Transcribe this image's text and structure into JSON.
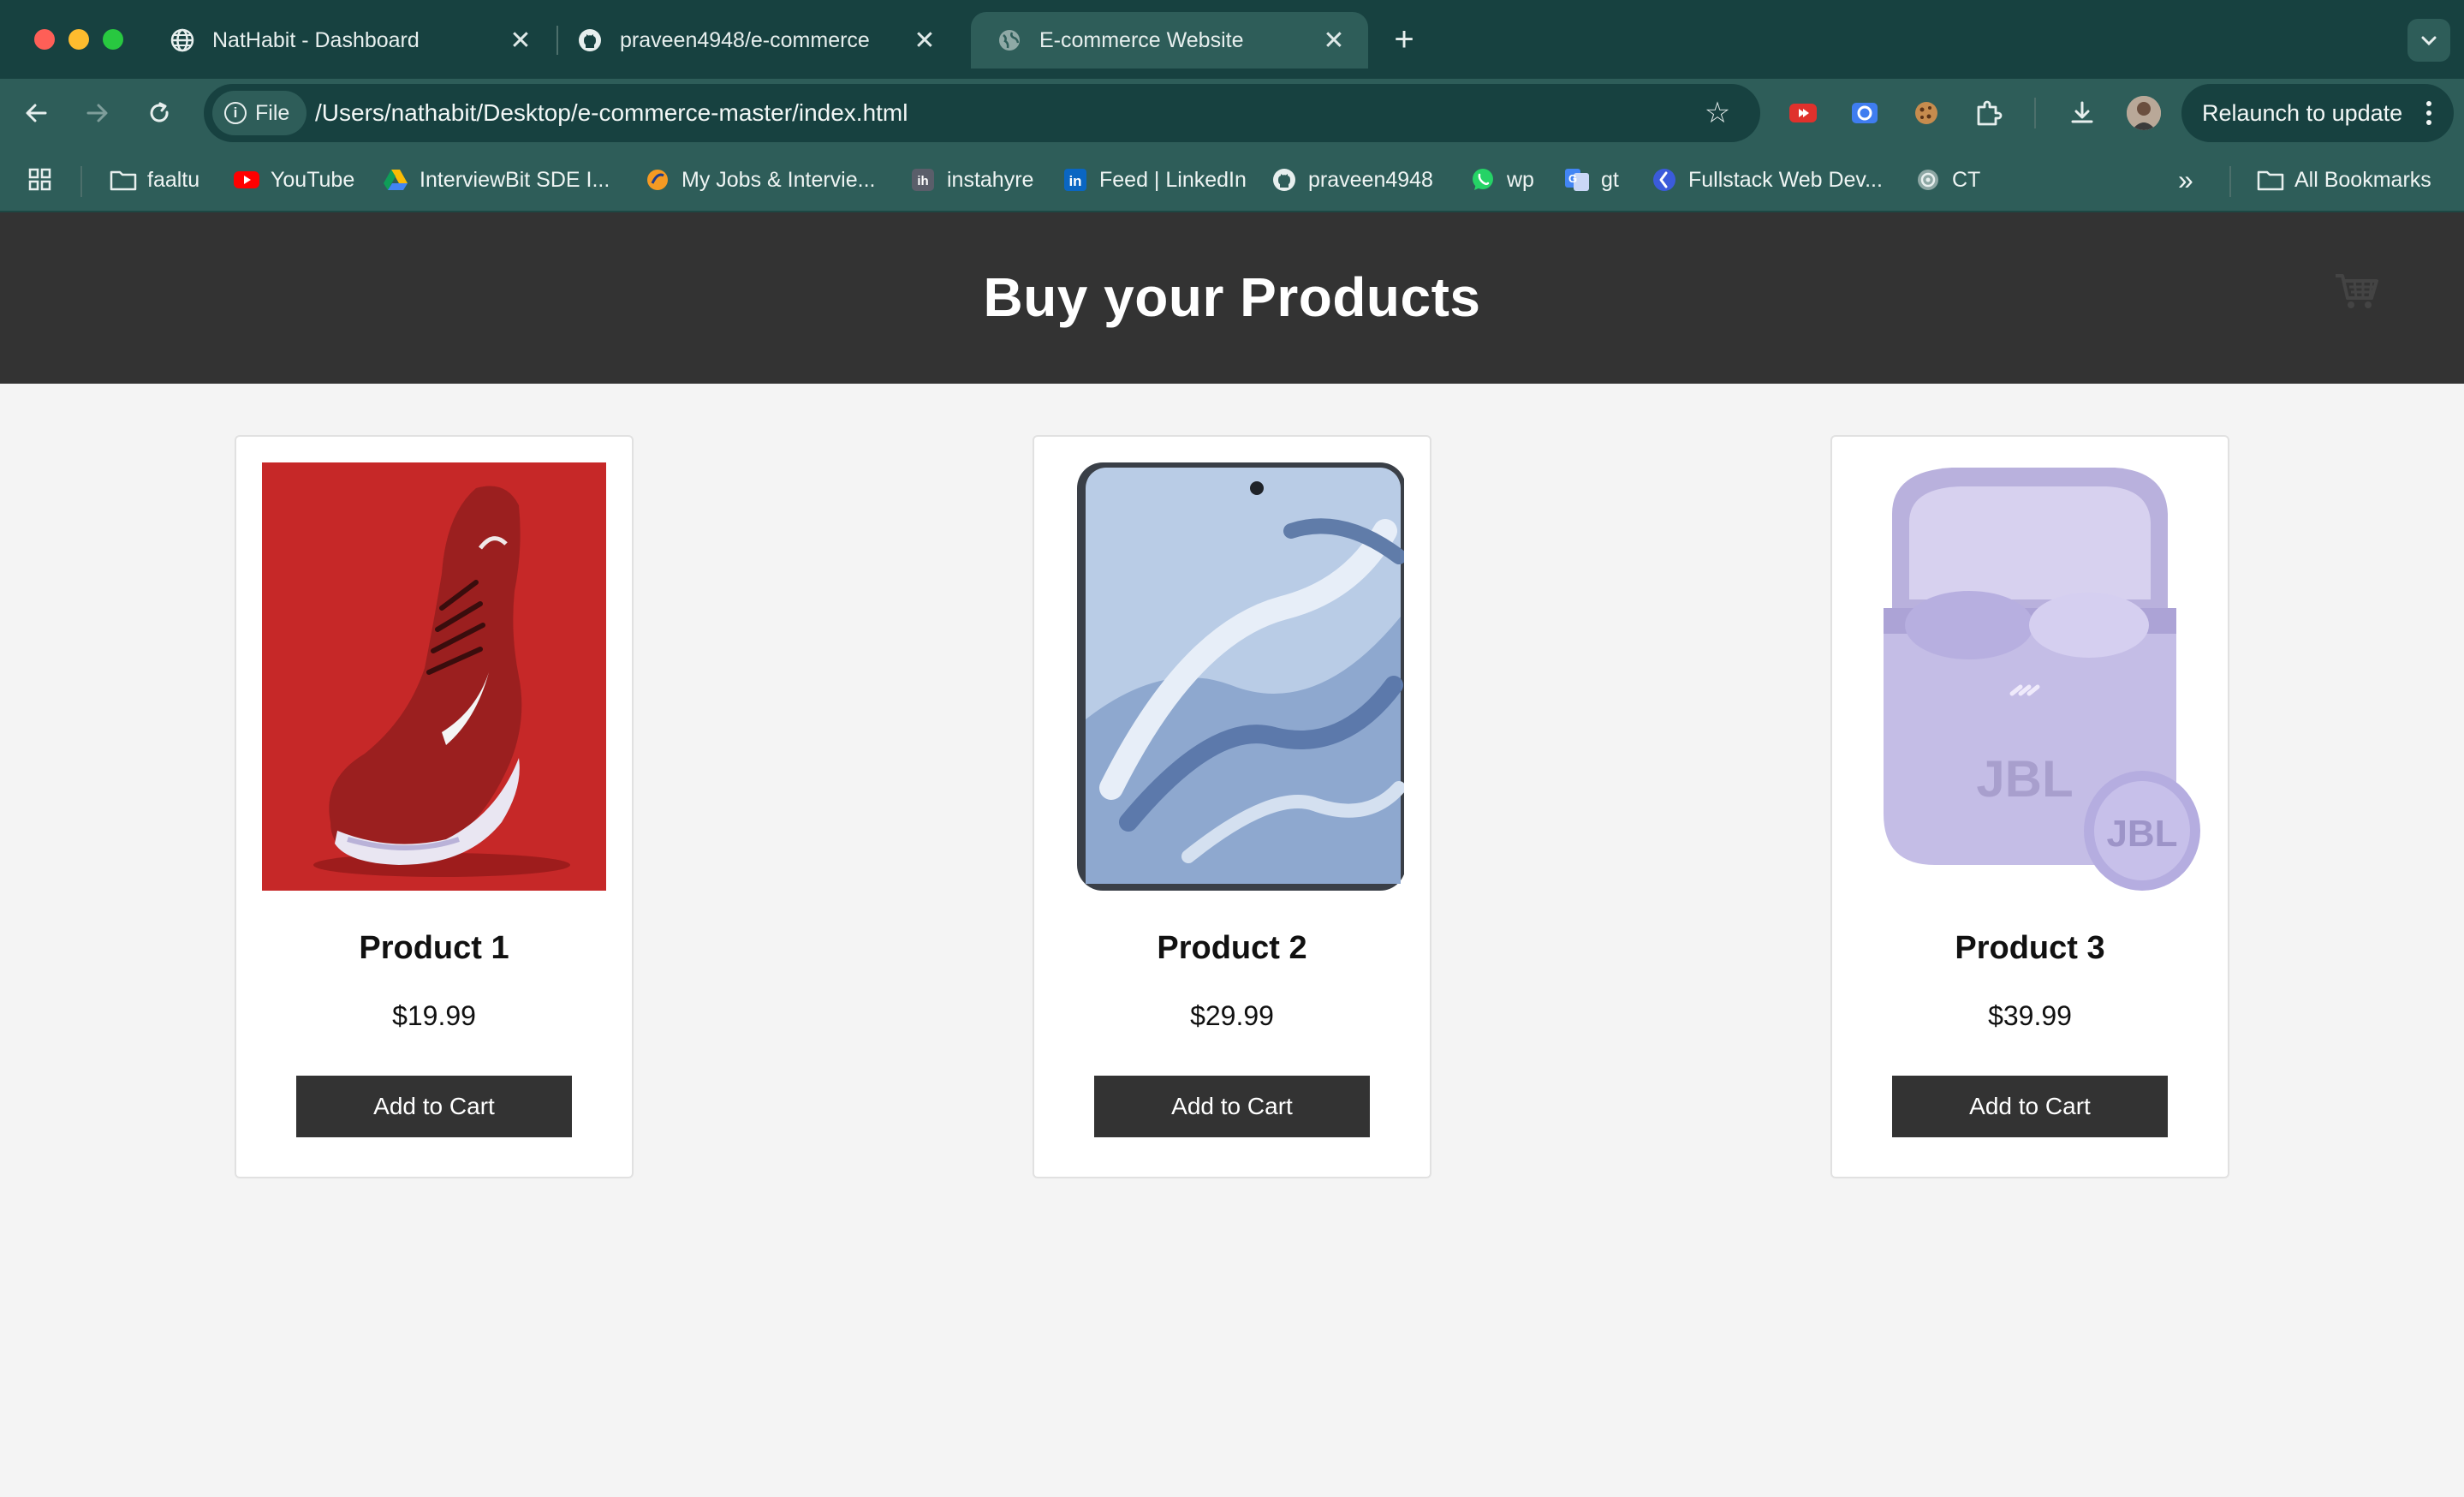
{
  "browser": {
    "tabs": [
      {
        "title": "NatHabit - Dashboard",
        "icon": "globe-icon",
        "active": false
      },
      {
        "title": "praveen4948/e-commerce",
        "icon": "github-icon",
        "active": false
      },
      {
        "title": "E-commerce Website",
        "icon": "globe-icon",
        "active": true
      }
    ],
    "new_tab": "+",
    "address": {
      "scheme_chip": "File",
      "url": "/Users/nathabit/Desktop/e-commerce-master/index.html"
    },
    "relaunch_label": "Relaunch to update",
    "bookmarks": [
      {
        "label": "faaltu",
        "icon": "folder-icon"
      },
      {
        "label": "YouTube",
        "icon": "youtube-icon"
      },
      {
        "label": "InterviewBit SDE I...",
        "icon": "google-drive-icon"
      },
      {
        "label": "My Jobs & Intervie...",
        "icon": "jobs-icon"
      },
      {
        "label": "instahyre",
        "icon": "instahyre-icon"
      },
      {
        "label": "Feed | LinkedIn",
        "icon": "linkedin-icon"
      },
      {
        "label": "praveen4948",
        "icon": "github-icon"
      },
      {
        "label": "wp",
        "icon": "whatsapp-icon"
      },
      {
        "label": "gt",
        "icon": "google-translate-icon"
      },
      {
        "label": "Fullstack Web Dev...",
        "icon": "course-icon"
      },
      {
        "label": "CT",
        "icon": "chatgpt-icon"
      }
    ],
    "overflow": "»",
    "all_bookmarks": "All Bookmarks"
  },
  "site": {
    "title": "Buy your Products",
    "cart_icon": "shopping-cart-icon"
  },
  "products": [
    {
      "name": "Product 1",
      "price": "$19.99",
      "button": "Add to Cart",
      "image": "red sneaker"
    },
    {
      "name": "Product 2",
      "price": "$29.99",
      "button": "Add to Cart",
      "image": "smartphone"
    },
    {
      "name": "Product 3",
      "price": "$39.99",
      "button": "Add to Cart",
      "image": "lavender earbuds"
    }
  ],
  "colors": {
    "header_bg": "#333333",
    "page_bg": "#f4f4f4",
    "button_bg": "#333333",
    "chrome_bg": "#2e5d59"
  }
}
